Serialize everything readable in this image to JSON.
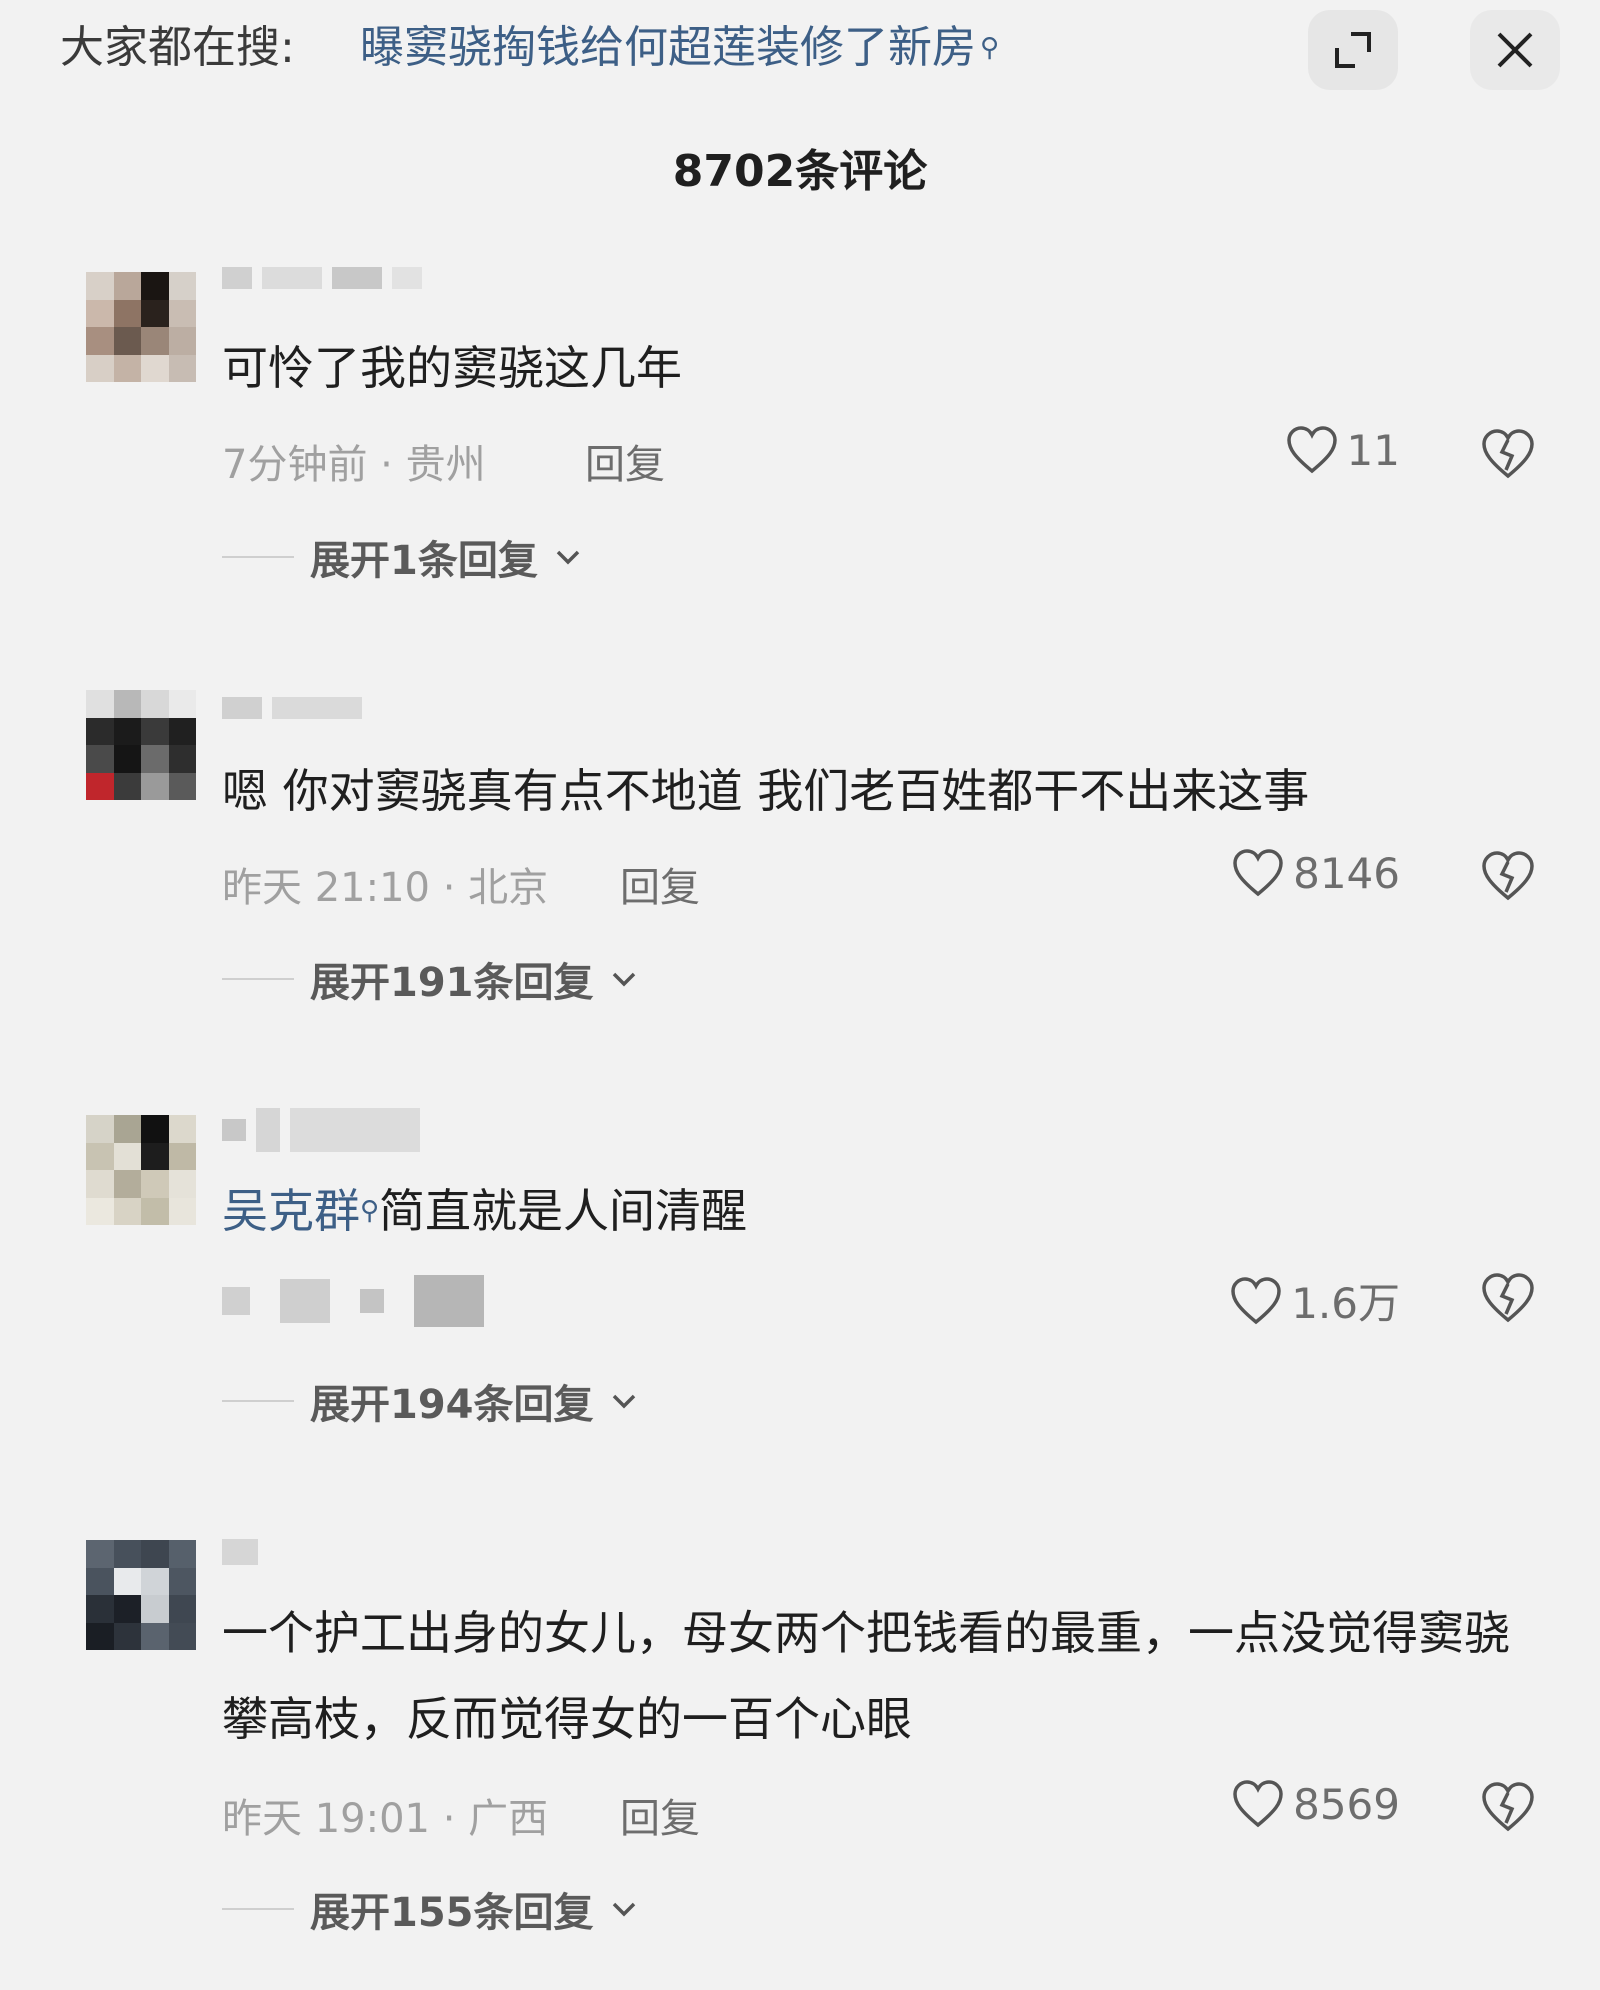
{
  "search_bar": {
    "prefix": "大家都在搜:",
    "query": "曝窦骁掏钱给何超莲装修了新房"
  },
  "header": {
    "comment_count": "8702条评论"
  },
  "icons": {
    "expand": "expand-icon",
    "close": "close-icon",
    "search": "search-icon",
    "like": "heart-icon",
    "dislike": "broken-heart-icon",
    "chevron": "chevron-down-icon"
  },
  "colors": {
    "background": "#f2f2f2",
    "link": "#3d5f86",
    "meta": "#a0a0a0"
  },
  "comments": [
    {
      "text": "可怜了我的窦骁这几年",
      "meta": "7分钟前 · 贵州",
      "reply_label": "回复",
      "likes": "11",
      "expand_label": "展开1条回复"
    },
    {
      "text": "嗯 你对窦骁真有点不地道 我们老百姓都干不出来这事",
      "meta": "昨天 21:10 · 北京",
      "reply_label": "回复",
      "likes": "8146",
      "expand_label": "展开191条回复"
    },
    {
      "mention": "吴克群",
      "text": "简直就是人间清醒",
      "likes": "1.6万",
      "expand_label": "展开194条回复"
    },
    {
      "text": "一个护工出身的女儿，母女两个把钱看的最重，一点没觉得窦骁攀高枝，反而觉得女的一百个心眼",
      "meta": "昨天 19:01 · 广西",
      "reply_label": "回复",
      "likes": "8569",
      "expand_label": "展开155条回复"
    }
  ]
}
